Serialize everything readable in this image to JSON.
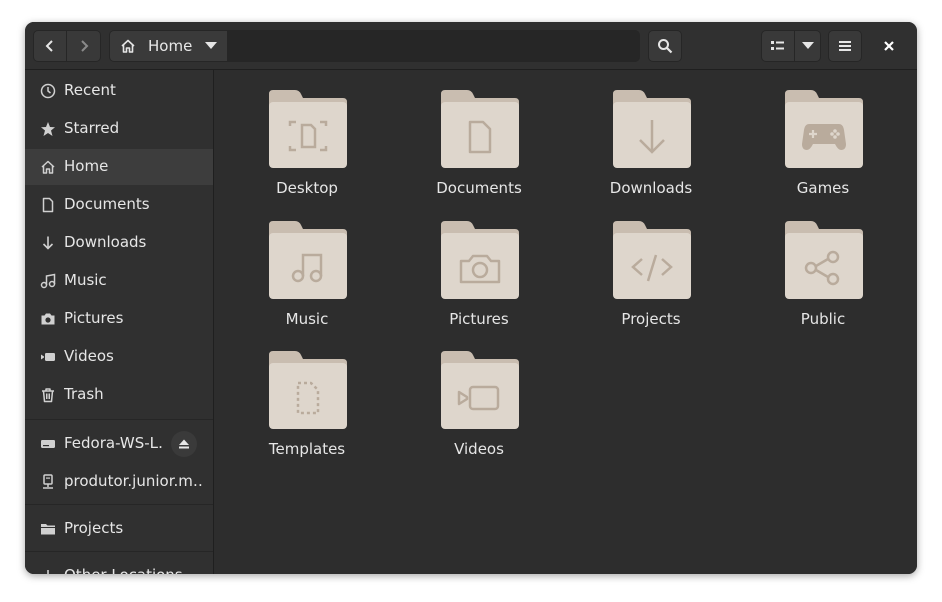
{
  "window": {
    "title": "Home"
  },
  "header": {
    "back_icon": "go-previous-icon",
    "forward_icon": "go-next-icon",
    "path": {
      "home_icon": "home-icon",
      "label": "Home",
      "dropdown_icon": "pan-down-icon"
    },
    "search_icon": "search-icon",
    "view_list_icon": "view-list-icon",
    "view_menu_icon": "pan-down-icon",
    "main_menu_icon": "open-menu-icon",
    "close_icon": "close-icon"
  },
  "sidebar": {
    "items": [
      {
        "label": "Recent",
        "icon": "recent-icon"
      },
      {
        "label": "Starred",
        "icon": "starred-icon"
      },
      {
        "label": "Home",
        "icon": "home-icon",
        "active": true
      },
      {
        "label": "Documents",
        "icon": "document-icon"
      },
      {
        "label": "Downloads",
        "icon": "download-icon"
      },
      {
        "label": "Music",
        "icon": "music-icon"
      },
      {
        "label": "Pictures",
        "icon": "camera-icon"
      },
      {
        "label": "Videos",
        "icon": "video-icon"
      },
      {
        "label": "Trash",
        "icon": "trash-icon"
      }
    ],
    "devices": [
      {
        "label": "Fedora-WS-L…",
        "icon": "drive-icon",
        "eject_icon": "eject-icon"
      },
      {
        "label": "produtor.junior.m…",
        "icon": "network-drive-icon"
      }
    ],
    "bookmarks": [
      {
        "label": "Projects",
        "icon": "folder-icon"
      }
    ],
    "other": {
      "label": "Other Locations",
      "icon": "plus-icon"
    }
  },
  "folders": [
    {
      "label": "Desktop",
      "glyph": "desktop-icon"
    },
    {
      "label": "Documents",
      "glyph": "document-icon"
    },
    {
      "label": "Downloads",
      "glyph": "download-icon"
    },
    {
      "label": "Games",
      "glyph": "gamepad-icon"
    },
    {
      "label": "Music",
      "glyph": "music-icon"
    },
    {
      "label": "Pictures",
      "glyph": "camera-icon"
    },
    {
      "label": "Projects",
      "glyph": "code-icon"
    },
    {
      "label": "Public",
      "glyph": "share-icon"
    },
    {
      "label": "Templates",
      "glyph": "template-icon"
    },
    {
      "label": "Videos",
      "glyph": "video-icon"
    }
  ],
  "colors": {
    "window_bg": "#2d2d2d",
    "sidebar_bg": "#303030",
    "folder": "#ded6cc",
    "folder_tab": "#c9bdb0",
    "folder_glyph": "#b9ab9c"
  }
}
